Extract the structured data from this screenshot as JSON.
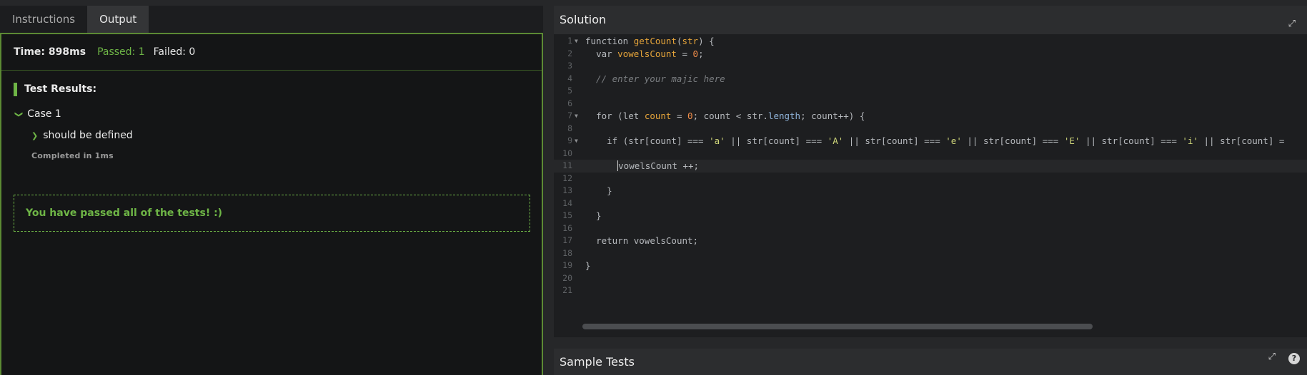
{
  "tabs": [
    {
      "label": "Instructions",
      "active": false
    },
    {
      "label": "Output",
      "active": true
    }
  ],
  "output": {
    "time": "Time: 898ms",
    "passed": "Passed: 1",
    "failed": "Failed: 0",
    "results_heading": "Test Results:",
    "case_label": "Case 1",
    "test_label": "should be defined",
    "completed": "Completed in 1ms",
    "success_message": "You have passed all of the tests! :)"
  },
  "solution": {
    "title": "Solution",
    "line_numbers": [
      "1",
      "2",
      "3",
      "4",
      "5",
      "6",
      "7",
      "8",
      "9",
      "10",
      "11",
      "12",
      "13",
      "14",
      "15",
      "16",
      "17",
      "18",
      "19",
      "20",
      "21"
    ],
    "code": {
      "l1": "function getCount(str) {",
      "l2": "  var vowelsCount = 0;",
      "l4": "  // enter your majic here",
      "l7": "  for (let count = 0; count < str.length; count++) {",
      "l9": "    if (str[count] === 'a' || str[count] === 'A' || str[count] === 'e' || str[count] === 'E' || str[count] === 'i' || str[count] =",
      "l11": "      vowelsCount ++;",
      "l13": "    }",
      "l15": "  }",
      "l17": "  return vowelsCount;",
      "l19": "}"
    }
  },
  "sample_tests": {
    "title": "Sample Tests"
  },
  "icons": {
    "expand": "expand-icon",
    "help": "help-icon",
    "chevron": "chevron-icon"
  },
  "colors": {
    "accent_green": "#6eb546",
    "keyword_orange": "#e5a43a",
    "string_yellow": "#cfd67a"
  }
}
